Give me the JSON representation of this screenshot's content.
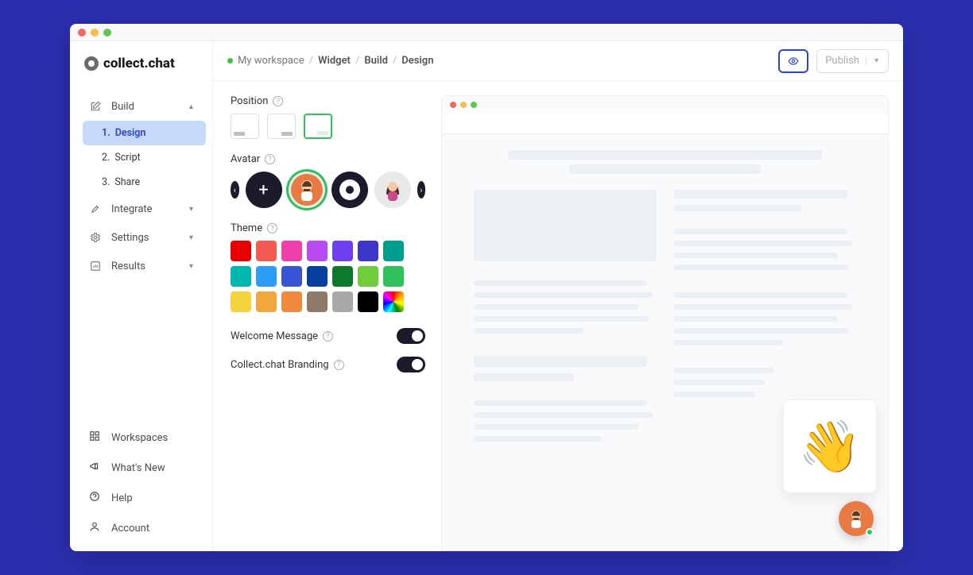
{
  "logo": "collect.chat",
  "sidebar": {
    "build": {
      "label": "Build"
    },
    "subitems": [
      {
        "n": "1.",
        "label": "Design"
      },
      {
        "n": "2.",
        "label": "Script"
      },
      {
        "n": "3.",
        "label": "Share"
      }
    ],
    "integrate": "Integrate",
    "settings": "Settings",
    "results": "Results",
    "bottom": {
      "workspaces": "Workspaces",
      "whatsnew": "What's New",
      "help": "Help",
      "account": "Account"
    }
  },
  "breadcrumb": {
    "workspace": "My workspace",
    "widget": "Widget",
    "build": "Build",
    "design": "Design"
  },
  "publish": "Publish",
  "panel": {
    "position": "Position",
    "avatar": "Avatar",
    "theme": "Theme",
    "welcome": "Welcome Message",
    "branding": "Collect.chat Branding"
  },
  "themeColors": [
    "#e60000",
    "#f25a52",
    "#ef3fa9",
    "#b84bef",
    "#6f3fef",
    "#3e36c9",
    "#009e8e",
    "#00b8b0",
    "#2a9df4",
    "#3a54d6",
    "#063f9e",
    "#0c7a2a",
    "#6fcc3a",
    "#2fc25b",
    "#f5d33c",
    "#f2a73c",
    "#ef8a3c",
    "#8f7a6a",
    "#a9a9a9"
  ],
  "toggles": {
    "welcome": true,
    "branding": true
  },
  "wave_emoji": "👋"
}
